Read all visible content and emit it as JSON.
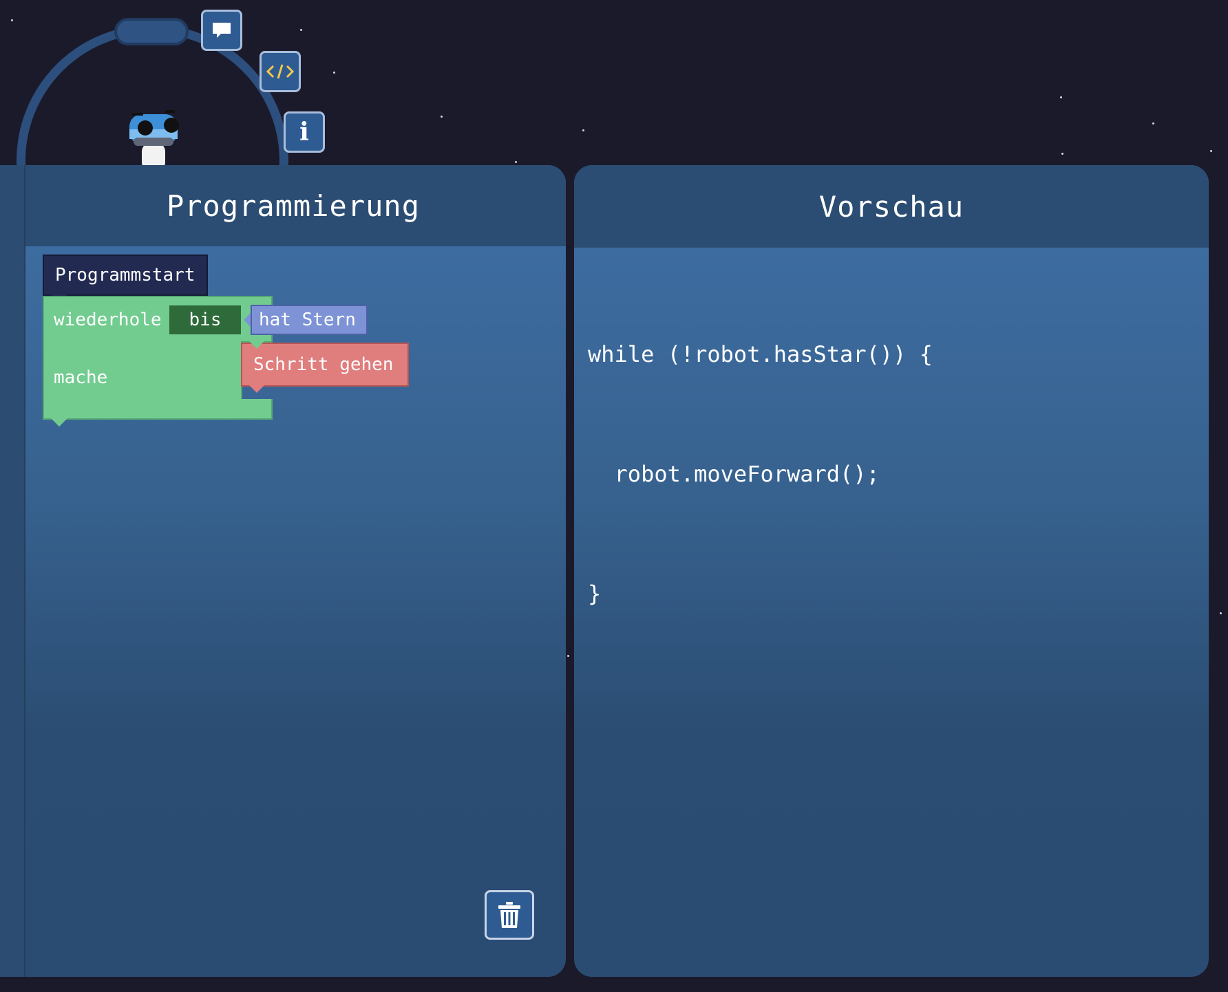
{
  "programming_panel": {
    "title": "Programmierung",
    "blocks": {
      "start": "Programmstart",
      "repeat_label": "wiederhole",
      "repeat_mode": "bis",
      "condition": "hat Stern",
      "do_label": "mache",
      "action": "Schritt gehen"
    }
  },
  "preview_panel": {
    "title": "Vorschau",
    "code_lines": [
      "while (!robot.hasStar()) {",
      "  robot.moveForward();",
      "}"
    ]
  },
  "toolbar": {
    "buttons": [
      {
        "icon": "speech-bubble-icon"
      },
      {
        "icon": "code-icon"
      },
      {
        "icon": "info-icon",
        "glyph": "i"
      }
    ]
  },
  "colors": {
    "background": "#1b1a2b",
    "panel_header": "#2c4d73",
    "block_start": "#232a52",
    "block_loop": "#72cc90",
    "block_condition": "#7d93d6",
    "block_action": "#e07d7d",
    "code_icon_accent": "#f2c84b"
  }
}
